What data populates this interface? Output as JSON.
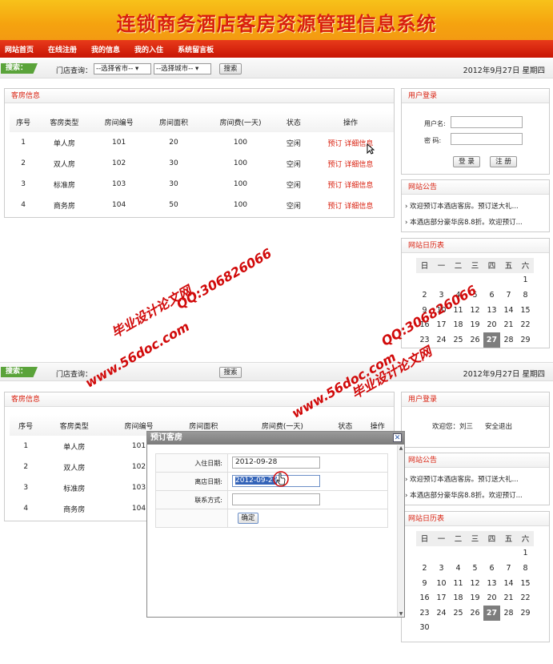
{
  "header": {
    "title": "连锁商务酒店客房资源管理信息系统"
  },
  "nav": {
    "items": [
      "网站首页",
      "在线注册",
      "我的信息",
      "我的入住",
      "系统留言板"
    ]
  },
  "search": {
    "tag": "搜索：",
    "label": "门店查询：",
    "province": "--选择省市--",
    "city": "--选择城市--",
    "button": "搜索",
    "date": "2012年9月27日  星期四"
  },
  "rooms": {
    "title": "客房信息",
    "columns": [
      "序号",
      "客房类型",
      "房间编号",
      "房间面积",
      "房间费(一天)",
      "状态",
      "操作"
    ],
    "rows": [
      {
        "no": "1",
        "type": "单人房",
        "num": "101",
        "area": "20",
        "price": "100",
        "status": "空闲"
      },
      {
        "no": "2",
        "type": "双人房",
        "num": "102",
        "area": "30",
        "price": "100",
        "status": "空闲"
      },
      {
        "no": "3",
        "type": "标准房",
        "num": "103",
        "area": "30",
        "price": "100",
        "status": "空闲"
      },
      {
        "no": "4",
        "type": "商务房",
        "num": "104",
        "area": "50",
        "price": "100",
        "status": "空闲"
      }
    ],
    "book": "预订",
    "detail": "详细信息"
  },
  "login": {
    "title": "用户登录",
    "user_label": "用户名:",
    "pass_label": "密  码:",
    "login_btn": "登 录",
    "register_btn": "注 册",
    "welcome": "欢迎您：刘三",
    "logout": "安全退出"
  },
  "notice": {
    "title": "网站公告",
    "items": [
      "欢迎预订本酒店客房。预订送大礼...",
      "本酒店部分豪华房8.8折。欢迎预订..."
    ]
  },
  "calendar": {
    "title": "网站日历表",
    "weekdays": [
      "日",
      "一",
      "二",
      "三",
      "四",
      "五",
      "六"
    ],
    "rows": [
      [
        "",
        "",
        "",
        "",
        "",
        "",
        "1"
      ],
      [
        "2",
        "3",
        "4",
        "5",
        "6",
        "7",
        "8"
      ],
      [
        "9",
        "10",
        "11",
        "12",
        "13",
        "14",
        "15"
      ],
      [
        "16",
        "17",
        "18",
        "19",
        "20",
        "21",
        "22"
      ],
      [
        "23",
        "24",
        "25",
        "26",
        "27",
        "28",
        "29"
      ],
      [
        "30",
        "",
        "",
        "",
        "",
        "",
        ""
      ]
    ],
    "today": "27"
  },
  "dialog": {
    "title": "预订客房",
    "checkin_label": "入住日期:",
    "checkin": "2012-09-28",
    "checkout_label": "离店日期:",
    "checkout": "2012-09-29",
    "contact_label": "联系方式:",
    "contact": "",
    "ok": "确定"
  },
  "watermark": {
    "site": "www.56doc.com",
    "qq": "QQ:306826066",
    "name": "毕业设计论文网"
  },
  "colors": {
    "accent": "#d9200f",
    "nav": "#d41c0a",
    "header": "#f5a30f",
    "search_tag": "#5aa33a"
  }
}
